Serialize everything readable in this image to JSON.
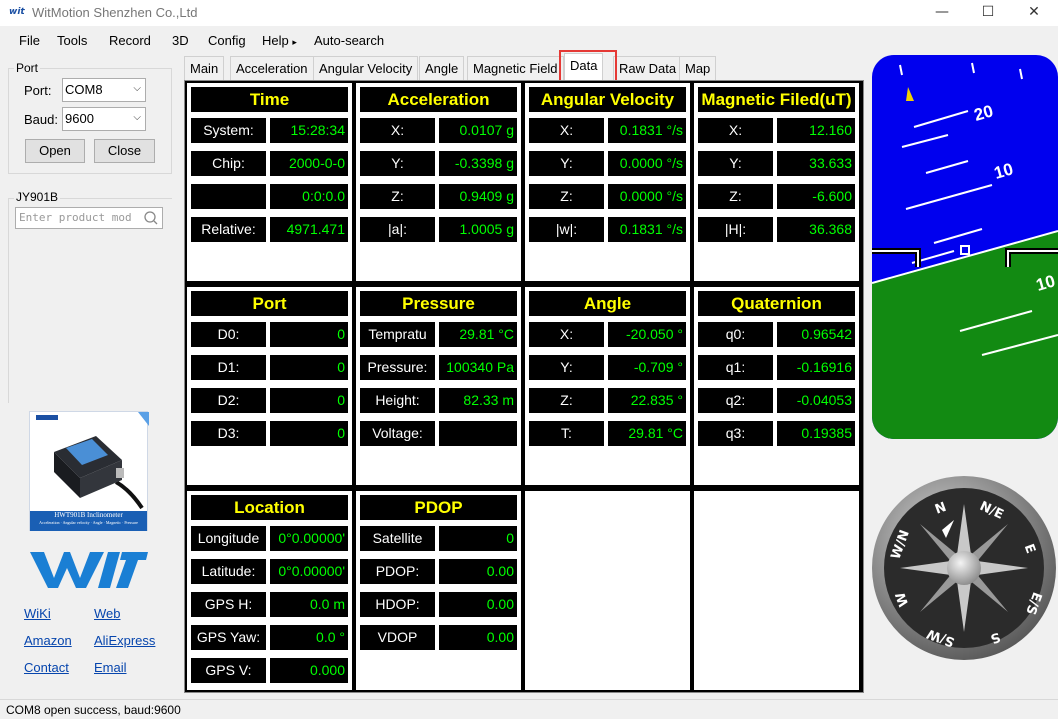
{
  "window": {
    "logo_text": "wit",
    "title": "WitMotion Shenzhen Co.,Ltd",
    "minimize": "—",
    "maximize": "☐",
    "close": "✕"
  },
  "menu": {
    "file": "File",
    "tools": "Tools",
    "record": "Record",
    "threed": "3D",
    "config": "Config",
    "help": "Help",
    "help_arrow": "▸",
    "autosearch": "Auto-search"
  },
  "port_group": {
    "label": "Port",
    "port_label": "Port:",
    "port_value": "COM8",
    "baud_label": "Baud:",
    "baud_value": "9600",
    "open": "Open",
    "close": "Close"
  },
  "product_group": {
    "label": "JY901B",
    "search_placeholder": "Enter product mod"
  },
  "product_image": {
    "caption_main": "HWT901B  Inclinometer",
    "caption_sub": "Acceleration · Angular velocity · Angle · Magnetic · Pressure"
  },
  "brand": {
    "logo": "WIT",
    "color": "#1a7fd4"
  },
  "links": {
    "wiki": "WiKi",
    "web": "Web",
    "amazon": "Amazon",
    "aliexpress": "AliExpress",
    "contact": "Contact",
    "email": "Email"
  },
  "tabs": [
    "Main",
    "Acceleration",
    "Angular Velocity",
    "Angle",
    "Magnetic Field",
    "Data",
    "Raw Data",
    "Map"
  ],
  "active_tab": "Data",
  "panels": {
    "time": {
      "title": "Time",
      "rows": [
        {
          "label": "System:",
          "value": "15:28:34"
        },
        {
          "label": "Chip:",
          "value": "2000-0-0"
        },
        {
          "label": "",
          "value": "0:0:0.0"
        },
        {
          "label": "Relative:",
          "value": "4971.471"
        }
      ]
    },
    "acceleration": {
      "title": "Acceleration",
      "rows": [
        {
          "label": "X:",
          "value": "0.0107 g"
        },
        {
          "label": "Y:",
          "value": "-0.3398 g"
        },
        {
          "label": "Z:",
          "value": "0.9409 g"
        },
        {
          "label": "|a|:",
          "value": "1.0005 g"
        }
      ]
    },
    "angular_velocity": {
      "title": "Angular Velocity",
      "rows": [
        {
          "label": "X:",
          "value": "0.1831 °/s"
        },
        {
          "label": "Y:",
          "value": "0.0000 °/s"
        },
        {
          "label": "Z:",
          "value": "0.0000 °/s"
        },
        {
          "label": "|w|:",
          "value": "0.1831 °/s"
        }
      ]
    },
    "magnetic": {
      "title": "Magnetic Filed(uT)",
      "rows": [
        {
          "label": "X:",
          "value": "12.160"
        },
        {
          "label": "Y:",
          "value": "33.633"
        },
        {
          "label": "Z:",
          "value": "-6.600"
        },
        {
          "label": "|H|:",
          "value": "36.368"
        }
      ]
    },
    "port": {
      "title": "Port",
      "rows": [
        {
          "label": "D0:",
          "value": "0"
        },
        {
          "label": "D1:",
          "value": "0"
        },
        {
          "label": "D2:",
          "value": "0"
        },
        {
          "label": "D3:",
          "value": "0"
        }
      ]
    },
    "pressure": {
      "title": "Pressure",
      "rows": [
        {
          "label": "Tempratu",
          "value": "29.81 °C"
        },
        {
          "label": "Pressure:",
          "value": "100340 Pa"
        },
        {
          "label": "Height:",
          "value": "82.33 m"
        },
        {
          "label": "Voltage:",
          "value": ""
        }
      ]
    },
    "angle": {
      "title": "Angle",
      "rows": [
        {
          "label": "X:",
          "value": "-20.050 °"
        },
        {
          "label": "Y:",
          "value": "-0.709 °"
        },
        {
          "label": "Z:",
          "value": "22.835 °"
        },
        {
          "label": "T:",
          "value": "29.81 °C"
        }
      ]
    },
    "quaternion": {
      "title": "Quaternion",
      "rows": [
        {
          "label": "q0:",
          "value": "0.96542"
        },
        {
          "label": "q1:",
          "value": "-0.16916"
        },
        {
          "label": "q2:",
          "value": "-0.04053"
        },
        {
          "label": "q3:",
          "value": "0.19385"
        }
      ]
    },
    "location": {
      "title": "Location",
      "rows": [
        {
          "label": "Longitude",
          "value": "0°0.00000'"
        },
        {
          "label": "Latitude:",
          "value": "0°0.00000'"
        },
        {
          "label": "GPS H:",
          "value": "0.0 m"
        },
        {
          "label": "GPS Yaw:",
          "value": "0.0 °"
        },
        {
          "label": "GPS V:",
          "value": "0.000"
        }
      ]
    },
    "pdop": {
      "title": "PDOP",
      "rows": [
        {
          "label": "Satellite",
          "value": "0"
        },
        {
          "label": "PDOP:",
          "value": "0.00"
        },
        {
          "label": "HDOP:",
          "value": "0.00"
        },
        {
          "label": "VDOP",
          "value": "0.00"
        }
      ]
    }
  },
  "attitude": {
    "marks": [
      "20",
      "10",
      "10"
    ],
    "sky_color": "#0000ee",
    "ground_color": "#128a12"
  },
  "compass": {
    "labels": [
      "N",
      "N/E",
      "E",
      "E/S",
      "S",
      "S/W",
      "W",
      "W/N"
    ]
  },
  "status": "COM8 open success, baud:9600"
}
